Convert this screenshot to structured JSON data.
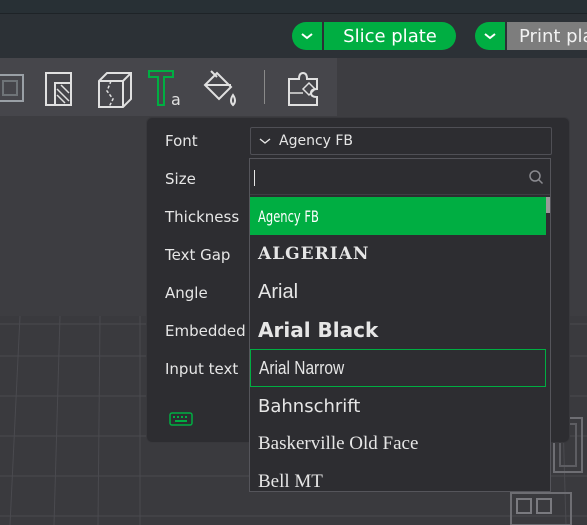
{
  "header": {
    "slice_label": "Slice plate",
    "print_label": "Print pla",
    "accent_color": "#00ae42",
    "print_color": "#7d7d7d"
  },
  "toolbar": {
    "tools": [
      "layer-cube-icon",
      "cut-icon",
      "split-cube-icon",
      "text-tool-icon",
      "paint-bucket-icon",
      "puzzle-assembly-icon"
    ]
  },
  "text_panel": {
    "labels": {
      "font": "Font",
      "size": "Size",
      "thickness": "Thickness",
      "text_gap": "Text Gap",
      "angle": "Angle",
      "embedded": "Embedded d",
      "input_text": "Input text"
    },
    "font_value": "Agency FB"
  },
  "font_dropdown": {
    "search_placeholder": "",
    "items": [
      {
        "label": "Agency FB",
        "state": "selected"
      },
      {
        "label": "ALGERIAN",
        "state": "normal"
      },
      {
        "label": "Arial",
        "state": "normal"
      },
      {
        "label": "Arial Black",
        "state": "normal"
      },
      {
        "label": "Arial Narrow",
        "state": "hover"
      },
      {
        "label": "Bahnschrift",
        "state": "normal"
      },
      {
        "label": "Baskerville Old Face",
        "state": "normal"
      },
      {
        "label": "Bell MT",
        "state": "normal"
      }
    ]
  }
}
